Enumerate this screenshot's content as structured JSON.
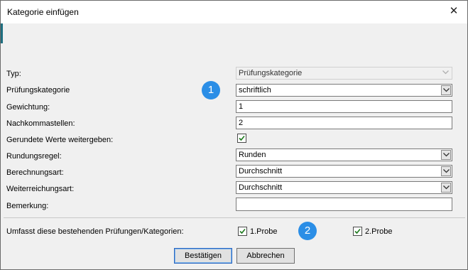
{
  "window": {
    "title": "Kategorie einfügen",
    "close_glyph": "✕"
  },
  "badges": [
    "1",
    "2"
  ],
  "form": {
    "typ": {
      "label": "Typ:",
      "value": "Prüfungskategorie"
    },
    "pruefungskategorie": {
      "label": "Prüfungskategorie",
      "value": "schriftlich"
    },
    "gewichtung": {
      "label": "Gewichtung:",
      "value": "1"
    },
    "nachkommastellen": {
      "label": "Nachkommastellen:",
      "value": "2"
    },
    "gerundete": {
      "label": "Gerundete Werte weitergeben:",
      "checked": true
    },
    "rundungsregel": {
      "label": "Rundungsregel:",
      "value": "Runden"
    },
    "berechnungsart": {
      "label": "Berechnungsart:",
      "value": "Durchschnitt"
    },
    "weiterreichungsart": {
      "label": "Weiterreichungsart:",
      "value": "Durchschnitt"
    },
    "bemerkung": {
      "label": "Bemerkung:",
      "value": ""
    }
  },
  "umfasst": {
    "label": "Umfasst diese bestehenden Prüfungen/Kategorien:",
    "items": [
      {
        "label": "1.Probe",
        "checked": true
      },
      {
        "label": "2.Probe",
        "checked": true
      }
    ]
  },
  "buttons": {
    "confirm": "Bestätigen",
    "cancel": "Abbrechen"
  }
}
